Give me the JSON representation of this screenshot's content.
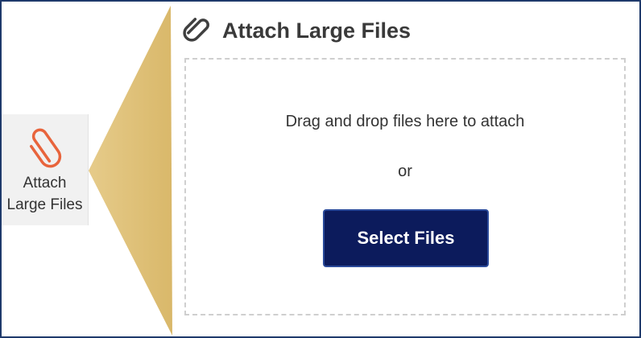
{
  "ribbon": {
    "button_label": "Attach Large Files",
    "icon": "paperclip-icon",
    "icon_color": "#e8643c"
  },
  "dialog": {
    "title": "Attach Large Files",
    "title_icon": "paperclip-icon",
    "dropzone": {
      "instruction": "Drag and drop files here to attach",
      "or_text": "or",
      "select_button_label": "Select Files"
    }
  },
  "colors": {
    "frame_border": "#1f3a6b",
    "callout_gold": "#dfc078",
    "button_navy": "#0c1b5c"
  }
}
